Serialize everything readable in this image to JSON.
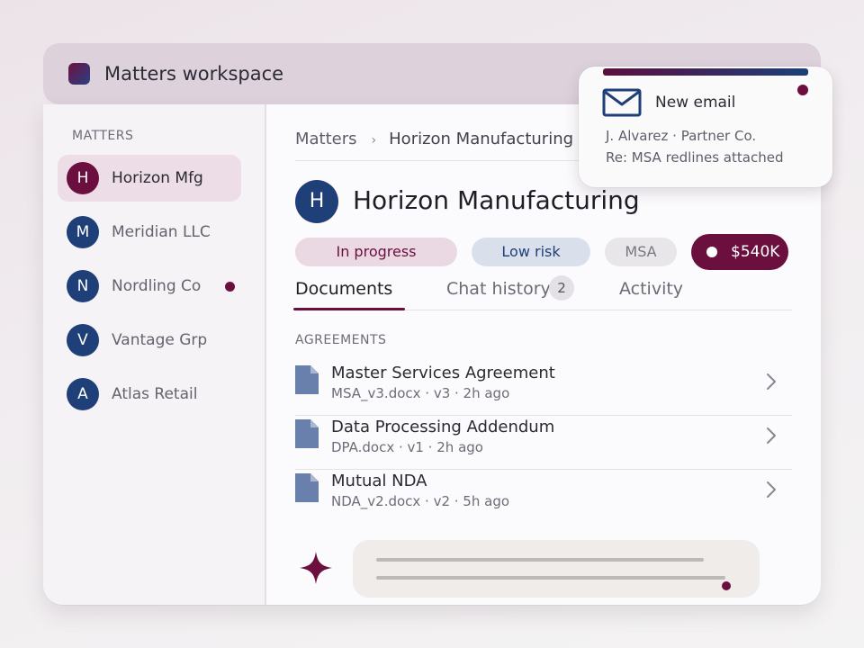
{
  "app": {
    "title": "Matters workspace"
  },
  "sidebar": {
    "section_label": "MATTERS",
    "items": [
      {
        "initial": "H",
        "label": "Horizon Mfg",
        "active": true
      },
      {
        "initial": "M",
        "label": "Meridian LLC"
      },
      {
        "initial": "N",
        "label": "Nordling Co",
        "unread": true
      },
      {
        "initial": "V",
        "label": "Vantage Grp"
      },
      {
        "initial": "A",
        "label": "Atlas Retail"
      }
    ]
  },
  "breadcrumb": {
    "root": "Matters",
    "separator": "›",
    "current": "Horizon Manufacturing"
  },
  "matter": {
    "initial": "H",
    "title": "Horizon Manufacturing",
    "status": "In progress",
    "risk": "Low risk",
    "type": "MSA",
    "value": "$540K"
  },
  "tabs": [
    {
      "label": "Documents",
      "active": true
    },
    {
      "label": "Chat history",
      "badge": "2"
    },
    {
      "label": "Activity"
    }
  ],
  "documents": {
    "section_label": "AGREEMENTS",
    "items": [
      {
        "title": "Master Services Agreement",
        "meta": "MSA_v3.docx · v3 · 2h ago"
      },
      {
        "title": "Data Processing Addendum",
        "meta": "DPA.docx · v1 · 2h ago"
      },
      {
        "title": "Mutual NDA",
        "meta": "NDA_v2.docx · v2 · 5h ago"
      }
    ]
  },
  "notification": {
    "title": "New email",
    "sender": "J. Alvarez · Partner Co.",
    "subject": "Re: MSA redlines attached"
  },
  "colors": {
    "accent": "#6b0f3f",
    "navy": "#1f3f78",
    "status_bg": "#ead8e2",
    "risk_bg": "#d9e0eb"
  },
  "icons": [
    "document-icon",
    "chevron-right-icon",
    "mail-icon",
    "sparkle-icon",
    "app-logo-icon"
  ]
}
